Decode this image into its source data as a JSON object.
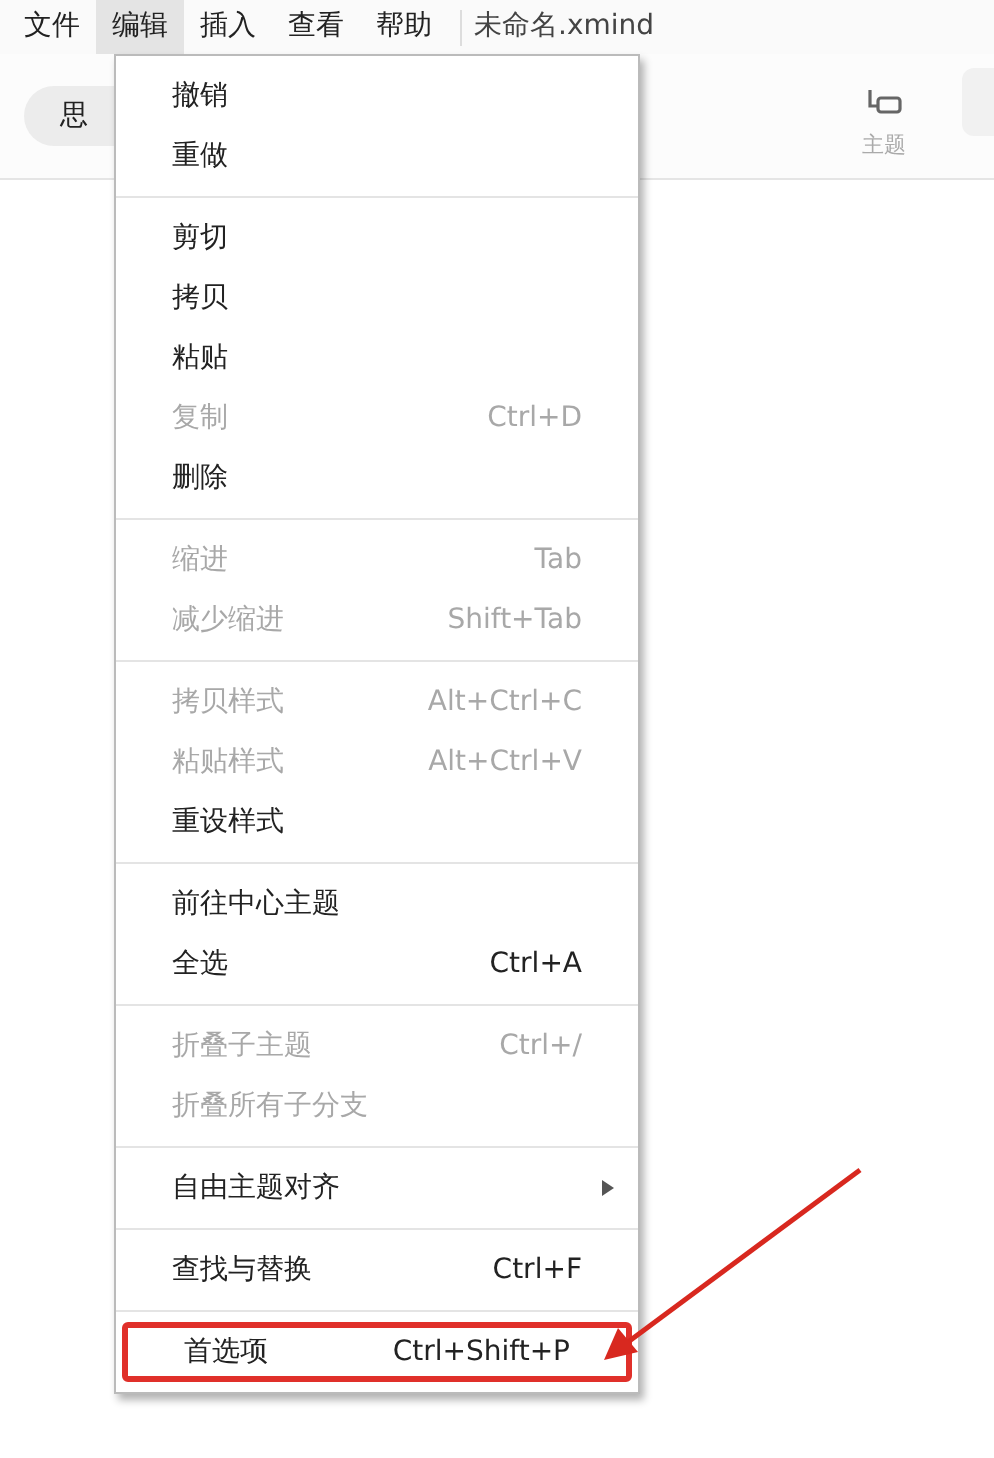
{
  "menu_bar": [
    {
      "label": "文件",
      "selected": false
    },
    {
      "label": "编辑",
      "selected": true
    },
    {
      "label": "插入",
      "selected": false
    },
    {
      "label": "查看",
      "selected": false
    },
    {
      "label": "帮助",
      "selected": false
    }
  ],
  "document_title": "未命名.xmind",
  "toolbar": {
    "mode_pill": "思",
    "topic_button": "主题"
  },
  "edit_menu": {
    "groups": [
      {
        "items": [
          {
            "label": "撤销",
            "disabled": false
          },
          {
            "label": "重做",
            "disabled": false
          }
        ]
      },
      {
        "items": [
          {
            "label": "剪切",
            "disabled": false
          },
          {
            "label": "拷贝",
            "disabled": false
          },
          {
            "label": "粘贴",
            "disabled": false
          },
          {
            "label": "复制",
            "shortcut": "Ctrl+D",
            "disabled": true
          },
          {
            "label": "删除",
            "disabled": false
          }
        ]
      },
      {
        "items": [
          {
            "label": "缩进",
            "shortcut": "Tab",
            "disabled": true
          },
          {
            "label": "减少缩进",
            "shortcut": "Shift+Tab",
            "disabled": true
          }
        ]
      },
      {
        "items": [
          {
            "label": "拷贝样式",
            "shortcut": "Alt+Ctrl+C",
            "disabled": true
          },
          {
            "label": "粘贴样式",
            "shortcut": "Alt+Ctrl+V",
            "disabled": true
          },
          {
            "label": "重设样式",
            "disabled": false
          }
        ]
      },
      {
        "items": [
          {
            "label": "前往中心主题",
            "disabled": false
          },
          {
            "label": "全选",
            "shortcut": "Ctrl+A",
            "disabled": false
          }
        ]
      },
      {
        "items": [
          {
            "label": "折叠子主题",
            "shortcut": "Ctrl+/",
            "disabled": true
          },
          {
            "label": "折叠所有子分支",
            "disabled": true
          }
        ]
      },
      {
        "items": [
          {
            "label": "自由主题对齐",
            "disabled": false,
            "submenu": true
          }
        ]
      },
      {
        "items": [
          {
            "label": "查找与替换",
            "shortcut": "Ctrl+F",
            "disabled": false
          }
        ]
      },
      {
        "items": [
          {
            "label": "首选项",
            "shortcut": "Ctrl+Shift+P",
            "disabled": false,
            "highlighted": true
          }
        ]
      }
    ]
  },
  "annotation": {
    "kind": "arrow"
  }
}
